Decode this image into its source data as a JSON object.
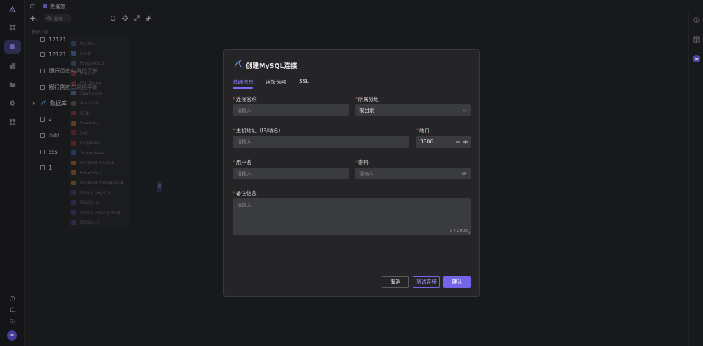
{
  "topbar": {
    "breadcrumb": "数据源"
  },
  "tree": {
    "search_placeholder": "搜索",
    "items": [
      {
        "label": "12121"
      },
      {
        "label": "12121"
      },
      {
        "label": "银行贷款与风控平衡"
      },
      {
        "label": "银行贷款与风控平衡"
      },
      {
        "label": "数据库"
      },
      {
        "label": "2"
      },
      {
        "label": "ddd"
      },
      {
        "label": "sss"
      },
      {
        "label": "1"
      }
    ],
    "ghost_label": "新建分组"
  },
  "db_list": [
    {
      "name": "MySQL",
      "color": "#3d6ea8"
    },
    {
      "name": "Doris",
      "color": "#5b8fd6"
    },
    {
      "name": "PostgreSQL",
      "color": "#4a77a8"
    },
    {
      "name": "Oracle",
      "color": "#b83a3a"
    },
    {
      "name": "SQLServer",
      "color": "#a33c3c"
    },
    {
      "name": "StarRocks",
      "color": "#5c9ad6"
    },
    {
      "name": "MariaDB",
      "color": "#8c6b4a"
    },
    {
      "name": "TiDB",
      "color": "#c23b3b"
    },
    {
      "name": "Starlinks",
      "color": "#c8823a"
    },
    {
      "name": "DM",
      "color": "#b03030"
    },
    {
      "name": "Kingbase",
      "color": "#c0392b"
    },
    {
      "name": "OceanBase",
      "color": "#3a6fd6"
    },
    {
      "name": "PolarDB-MySQL",
      "color": "#d77a2e"
    },
    {
      "name": "PolarDB-X",
      "color": "#d77a2e"
    },
    {
      "name": "PolarDB-PostgreSQL",
      "color": "#d77a2e"
    },
    {
      "name": "TDSQL-MySQL",
      "color": "#6a3a9e"
    },
    {
      "name": "TDSQL-A",
      "color": "#6a3a9e"
    },
    {
      "name": "TDSQL-PostgreSQL",
      "color": "#6a3a9e"
    },
    {
      "name": "TDSQL-C",
      "color": "#6a3a9e"
    }
  ],
  "modal": {
    "title": "创建MySQL连接",
    "tabs": [
      "基础信息",
      "连接选项",
      "SSL"
    ],
    "fields": {
      "conn_name": {
        "label": "连接名称",
        "placeholder": "请输入"
      },
      "group": {
        "label": "所属分组",
        "value": "根目录"
      },
      "host": {
        "label": "主机地址（IP/域名）",
        "placeholder": "请输入"
      },
      "port": {
        "label": "端口",
        "value": "3306"
      },
      "user": {
        "label": "用户名",
        "placeholder": "请输入"
      },
      "password": {
        "label": "密码",
        "placeholder": "请输入"
      },
      "remark": {
        "label": "备注信息",
        "placeholder": "请输入",
        "counter": "0 / 2000"
      }
    },
    "buttons": {
      "cancel": "取消",
      "test": "测试连接",
      "ok": "确认"
    }
  },
  "user": {
    "avatar": "VB"
  },
  "colors": {
    "accent": "#7465e8",
    "required": "#e04b4b"
  }
}
